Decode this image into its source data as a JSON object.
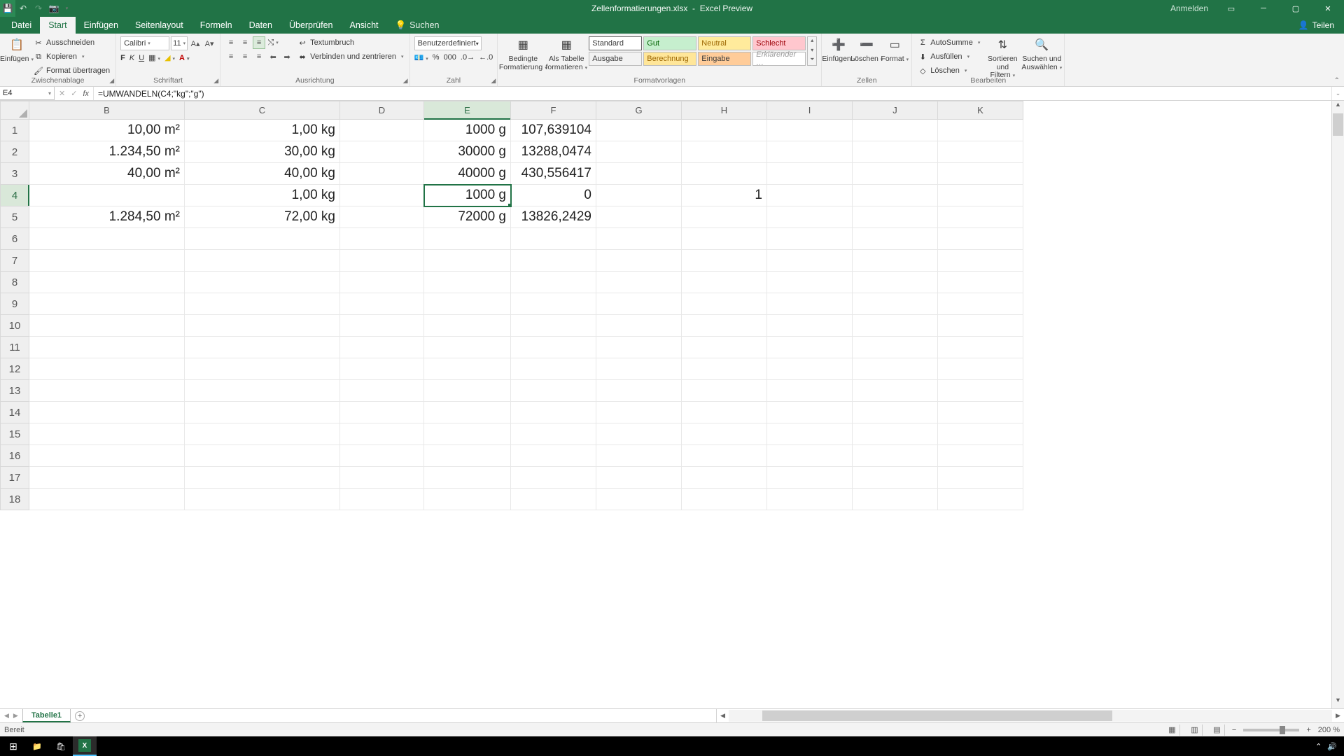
{
  "titlebar": {
    "filename": "Zellenformatierungen.xlsx",
    "appname": "Excel Preview",
    "signin": "Anmelden"
  },
  "tabs": {
    "file": "Datei",
    "home": "Start",
    "insert": "Einfügen",
    "pagelayout": "Seitenlayout",
    "formulas": "Formeln",
    "data": "Daten",
    "review": "Überprüfen",
    "view": "Ansicht",
    "search": "Suchen",
    "share": "Teilen"
  },
  "ribbon": {
    "clipboard": {
      "label": "Zwischenablage",
      "paste": "Einfügen",
      "cut": "Ausschneiden",
      "copy": "Kopieren",
      "painter": "Format übertragen"
    },
    "font": {
      "label": "Schriftart",
      "name": "Calibri",
      "size": "11",
      "bold": "F",
      "italic": "K",
      "underline": "U"
    },
    "alignment": {
      "label": "Ausrichtung",
      "wrap": "Textumbruch",
      "merge": "Verbinden und zentrieren"
    },
    "number": {
      "label": "Zahl",
      "format": "Benutzerdefiniert"
    },
    "styles": {
      "label": "Formatvorlagen",
      "conditional": "Bedingte Formatierung",
      "astable": "Als Tabelle formatieren",
      "standard": "Standard",
      "gut": "Gut",
      "neutral": "Neutral",
      "schlecht": "Schlecht",
      "ausgabe": "Ausgabe",
      "berechnung": "Berechnung",
      "eingabe": "Eingabe",
      "erkl": "Erklärender …"
    },
    "cells": {
      "label": "Zellen",
      "insert": "Einfügen",
      "delete": "Löschen",
      "format": "Format"
    },
    "editing": {
      "label": "Bearbeiten",
      "autosum": "AutoSumme",
      "fill": "Ausfüllen",
      "clear": "Löschen",
      "sort": "Sortieren und Filtern",
      "find": "Suchen und Auswählen"
    }
  },
  "fxbar": {
    "cellref": "E4",
    "formula": "=UMWANDELN(C4;\"kg\";\"g\")"
  },
  "grid": {
    "selected": {
      "col": "E",
      "row": 4
    },
    "columns": [
      "B",
      "C",
      "D",
      "E",
      "F",
      "G",
      "H",
      "I",
      "J",
      "K"
    ],
    "rows": [
      {
        "n": 1,
        "B": "10,00 m²",
        "C": "1,00 kg",
        "D": "",
        "E": "1000 g",
        "F": "107,639104",
        "G": "",
        "H": "",
        "I": "",
        "J": "",
        "K": ""
      },
      {
        "n": 2,
        "B": "1.234,50 m²",
        "C": "30,00 kg",
        "D": "",
        "E": "30000 g",
        "F": "13288,0474",
        "G": "",
        "H": "",
        "I": "",
        "J": "",
        "K": ""
      },
      {
        "n": 3,
        "B": "40,00 m²",
        "C": "40,00 kg",
        "D": "",
        "E": "40000 g",
        "F": "430,556417",
        "G": "",
        "H": "",
        "I": "",
        "J": "",
        "K": ""
      },
      {
        "n": 4,
        "B": "",
        "C": "1,00 kg",
        "D": "",
        "E": "1000 g",
        "F": "0",
        "G": "",
        "H": "1",
        "I": "",
        "J": "",
        "K": ""
      },
      {
        "n": 5,
        "B": "1.284,50 m²",
        "C": "72,00 kg",
        "D": "",
        "E": "72000 g",
        "F": "13826,2429",
        "G": "",
        "H": "",
        "I": "",
        "J": "",
        "K": ""
      }
    ],
    "emptyrows": [
      6,
      7,
      8,
      9,
      10,
      11,
      12,
      13,
      14,
      15,
      16,
      17,
      18
    ]
  },
  "sheets": {
    "tab": "Tabelle1"
  },
  "statusbar": {
    "ready": "Bereit",
    "zoom": "200 %"
  }
}
